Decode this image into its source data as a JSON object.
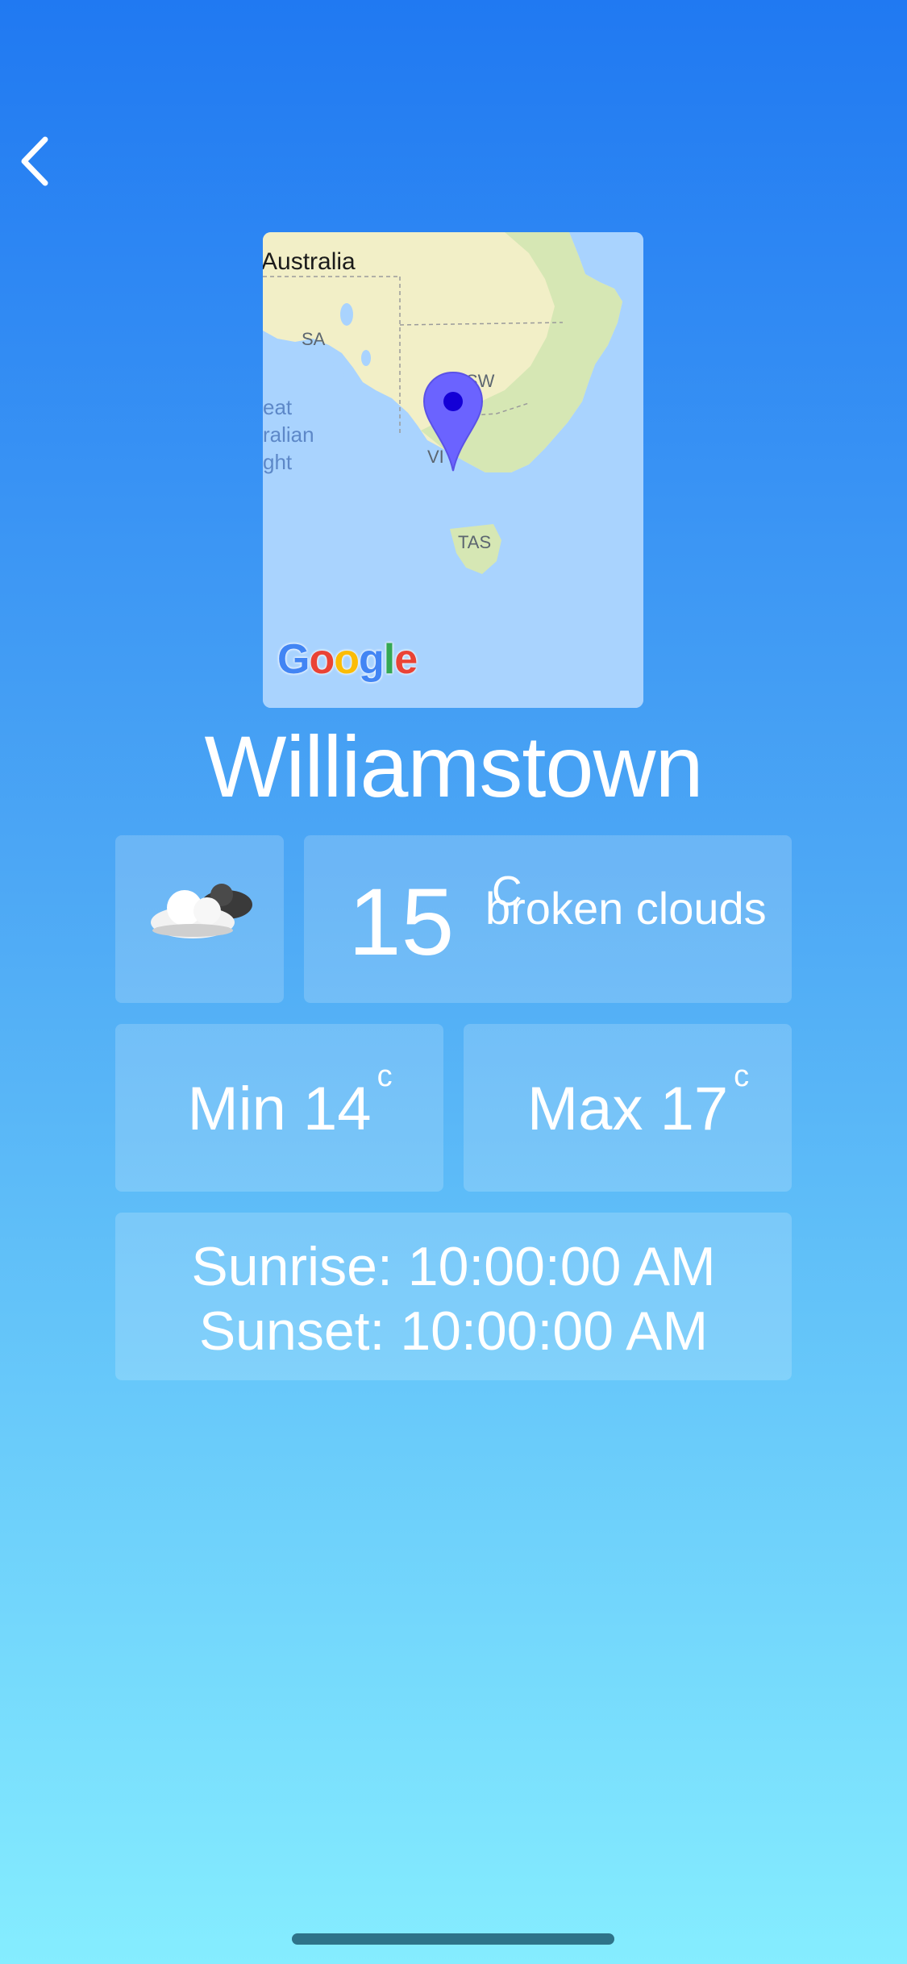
{
  "nav": {
    "back_icon": "chevron-left-icon"
  },
  "map": {
    "country_label": "Australia",
    "state_labels": {
      "sa": "SA",
      "nsw": "SW",
      "vic": "VI",
      "tas": "TAS"
    },
    "sea_label_lines": [
      "eat",
      "ralian",
      "ght"
    ],
    "logo_letters": [
      "G",
      "o",
      "o",
      "g",
      "l",
      "e"
    ],
    "logo_colors": [
      "#4285F4",
      "#EA4335",
      "#FBBC05",
      "#4285F4",
      "#34A853",
      "#EA4335"
    ],
    "pin_color": "#6B63FF",
    "pin_icon": "map-pin-icon"
  },
  "city": "Williamstown",
  "current": {
    "icon": "broken-clouds-icon",
    "temperature": "15",
    "unit": "C",
    "description": "broken clouds"
  },
  "min": {
    "label": "Min 14",
    "unit": "c"
  },
  "max": {
    "label": "Max 17",
    "unit": "c"
  },
  "sun": {
    "sunrise": "Sunrise: 10:00:00 AM",
    "sunset": "Sunset: 10:00:00 AM"
  },
  "colors": {
    "background_top": "#2079F2",
    "background_bottom": "#85EDFF",
    "card_fill": "rgba(255,255,255,0.18)",
    "map_water": "#A9D3FE",
    "map_land": "#F2EFC7"
  }
}
